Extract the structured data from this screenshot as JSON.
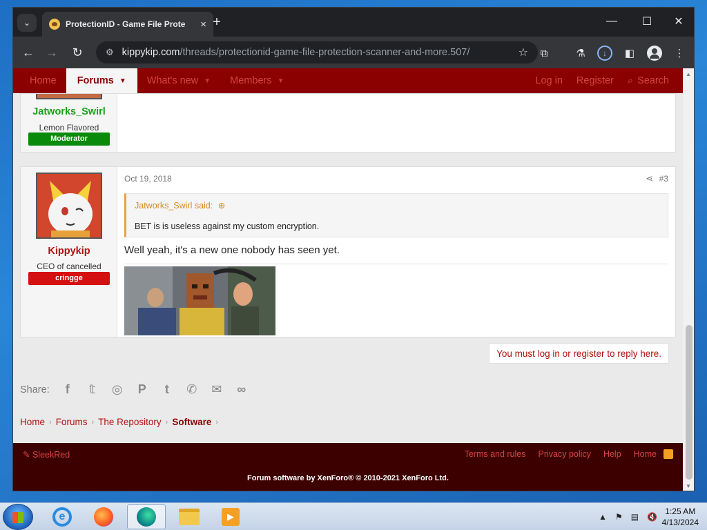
{
  "browser": {
    "tab_title": "ProtectionID - Game File Prote",
    "tab_close": "×",
    "new_tab": "+",
    "url_host": "kippykip.com",
    "url_path": "/threads/protectionid-game-file-protection-scanner-and-more.507/",
    "window_controls": {
      "minimize": "—",
      "maximize": "☐",
      "close": "✕"
    }
  },
  "nav": {
    "items": [
      {
        "label": "Home"
      },
      {
        "label": "Forums"
      },
      {
        "label": "What's new"
      },
      {
        "label": "Members"
      }
    ],
    "login": "Log in",
    "register": "Register",
    "search": "Search"
  },
  "post1": {
    "username": "Jatworks_Swirl",
    "user_title": "Lemon Flavored",
    "badge": "Moderator"
  },
  "post2": {
    "username": "Kippykip",
    "user_title": "CEO of cancelled",
    "badge": "cringge",
    "date": "Oct 19, 2018",
    "number": "#3",
    "quote_author": "Jatworks_Swirl said:",
    "quote_text": "BET is is useless against my custom encryption.",
    "text": "Well yeah, it's a new one nobody has seen yet."
  },
  "reply_prompt": "You must log in or register to reply here.",
  "share": {
    "label": "Share:"
  },
  "breadcrumb": [
    "Home",
    "Forums",
    "The Repository",
    "Software"
  ],
  "footer": {
    "style": "SleekRed",
    "links": [
      "Terms and rules",
      "Privacy policy",
      "Help",
      "Home"
    ],
    "copyright": "Forum software by XenForo® © 2010-2021 XenForo Ltd."
  },
  "taskbar": {
    "time": "1:25 AM",
    "date": "4/13/2024"
  },
  "colors": {
    "brand": "#8b0000",
    "moderator": "#0a8a0a",
    "badge_red": "#d41010"
  }
}
